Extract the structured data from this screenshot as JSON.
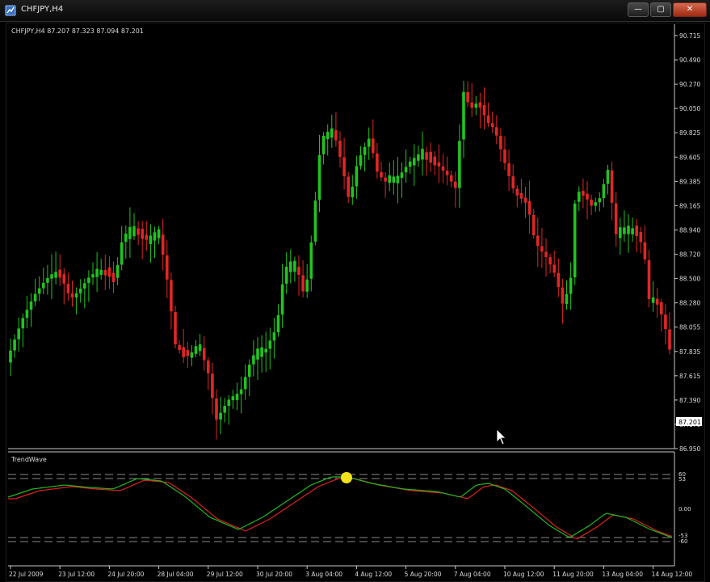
{
  "window": {
    "title": "CHFJPY,H4",
    "buttons": {
      "minimize": "—",
      "maximize": "▢",
      "close": "✕"
    }
  },
  "main_chart": {
    "info": "CHFJPY,H4  87.207 87.323 87.094 87.201",
    "current_price": "87.201",
    "price_labels": [
      "90.715",
      "90.490",
      "90.270",
      "90.050",
      "89.825",
      "89.605",
      "89.385",
      "89.165",
      "88.940",
      "88.720",
      "88.500",
      "88.280",
      "88.055",
      "87.835",
      "87.615",
      "87.390",
      "87.170",
      "86.950"
    ],
    "colors": {
      "bull": "#1fc41f",
      "bear": "#e02626",
      "background": "#000000",
      "axis": "#c8c8c8"
    }
  },
  "indicator": {
    "name": "TrendWave",
    "levels": [
      "60",
      "53",
      "0.00",
      "-53",
      "-60"
    ],
    "colors": {
      "fast": "#1fb81f",
      "slow": "#e02020",
      "level": "#8a8a8a",
      "marker": "#f2e21a"
    }
  },
  "time_labels": [
    "22 Jul 2009",
    "23 Jul 12:00",
    "24 Jul 20:00",
    "28 Jul 04:00",
    "29 Jul 12:00",
    "30 Jul 20:00",
    "3 Aug 04:00",
    "4 Aug 12:00",
    "5 Aug 20:00",
    "7 Aug 04:00",
    "10 Aug 12:00",
    "11 Aug 20:00",
    "13 Aug 04:00",
    "14 Aug 12:00"
  ]
}
